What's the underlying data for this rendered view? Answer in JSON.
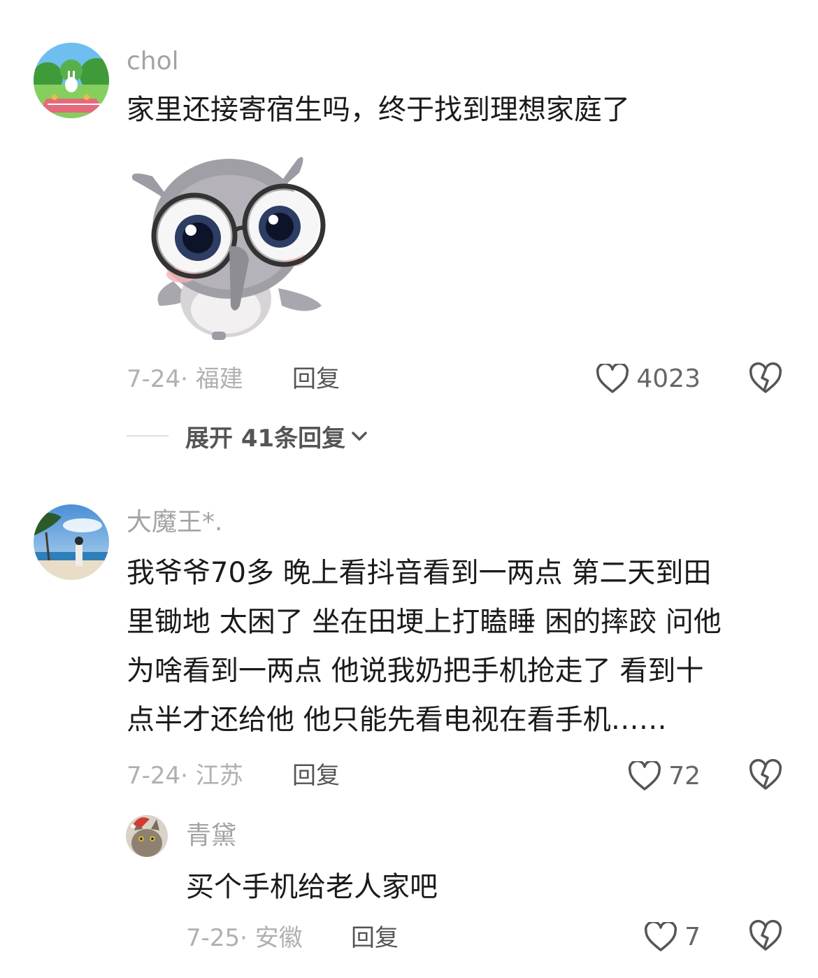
{
  "comments": [
    {
      "username": "chol",
      "text": "家里还接寄宿生吗，终于找到理想家庭了",
      "date": "7-24",
      "dot": "·",
      "location": "福建",
      "reply_label": "回复",
      "likes": "4023",
      "sticker": "gray-owl-with-glasses-sticker",
      "expand_label": "展开 41条回复",
      "icons": {
        "like": "heart-outline-icon",
        "dislike": "broken-heart-icon",
        "expand": "chevron-down-icon"
      }
    },
    {
      "username": "大魔王*.",
      "text_lines": [
        "我爷爷70多 晚上看抖音看到一两点 第二天到田",
        "里锄地 太困了 坐在田埂上打瞌睡 困的摔跤 问他",
        "为啥看到一两点 他说我奶把手机抢走了 看到十",
        "点半才还给他  他只能先看电视在看手机……"
      ],
      "date": "7-24",
      "dot": "·",
      "location": "江苏",
      "reply_label": "回复",
      "likes": "72"
    }
  ],
  "replies": [
    {
      "username": "青黛",
      "text": "买个手机给老人家吧",
      "date": "7-25",
      "dot": "·",
      "location": "安徽",
      "reply_label": "回复",
      "likes": "7"
    }
  ],
  "colors": {
    "text": "#1a1a1a",
    "muted": "#b0b0b0",
    "username": "#a3a3a3",
    "action": "#555555"
  }
}
